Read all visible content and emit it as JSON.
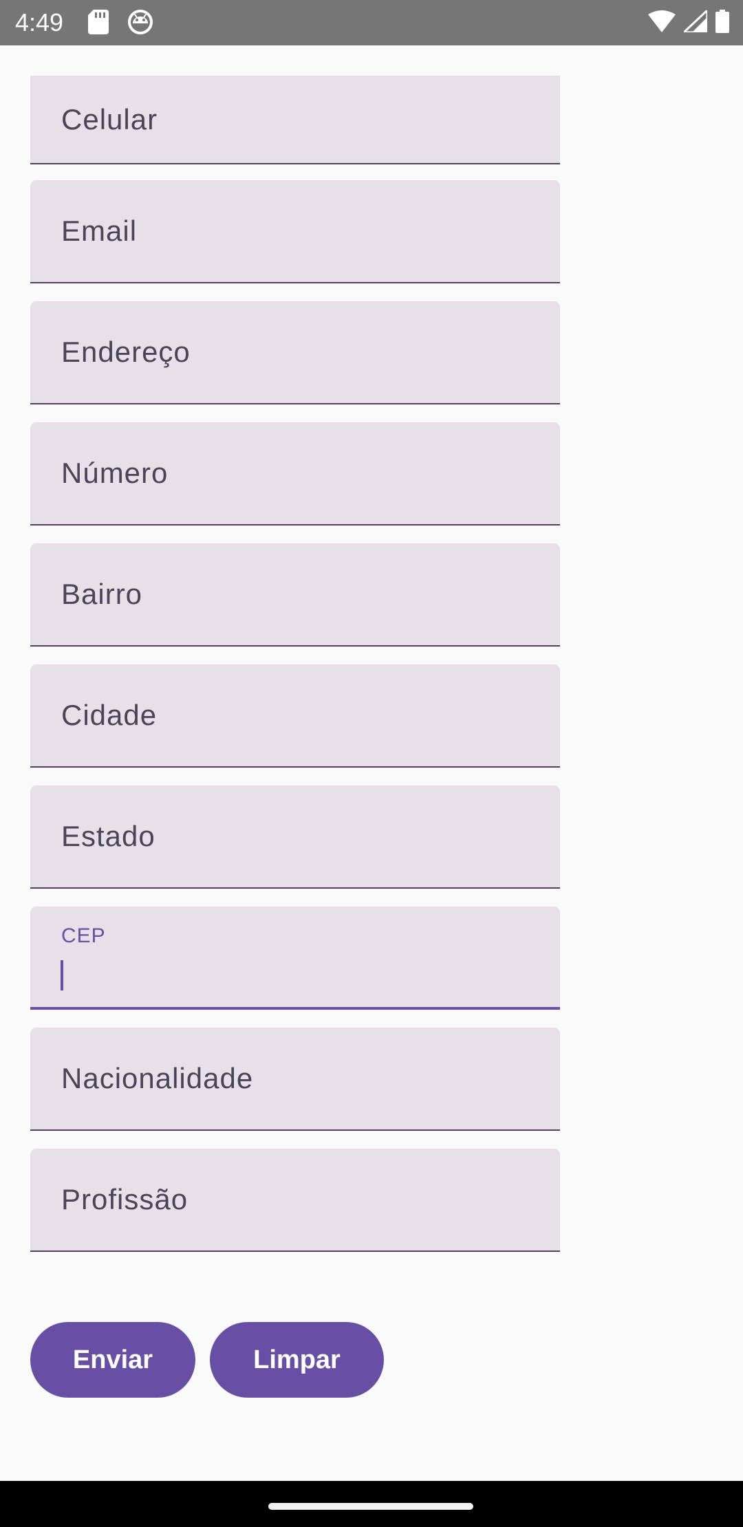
{
  "status_bar": {
    "time": "4:49",
    "icons": [
      "sd-card-icon",
      "android-icon",
      "wifi-icon",
      "signal-icon",
      "battery-icon"
    ]
  },
  "form": {
    "fields": [
      {
        "label": "Celular"
      },
      {
        "label": "Email"
      },
      {
        "label": "Endereço"
      },
      {
        "label": "Número"
      },
      {
        "label": "Bairro"
      },
      {
        "label": "Cidade"
      },
      {
        "label": "Estado"
      },
      {
        "label": "CEP",
        "value": "",
        "focused": true
      },
      {
        "label": "Nacionalidade"
      },
      {
        "label": "Profissão"
      }
    ]
  },
  "buttons": {
    "submit_label": "Enviar",
    "clear_label": "Limpar"
  },
  "colors": {
    "accent": "#6750A4",
    "field_background": "#E7E0E8",
    "background": "#FAFAFA",
    "status_bar": "#767676"
  }
}
